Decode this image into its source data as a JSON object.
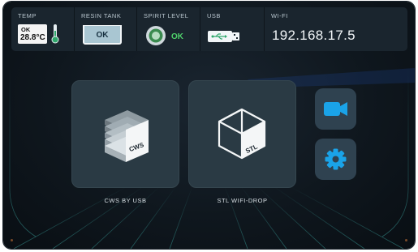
{
  "status_bar": {
    "temp": {
      "title": "TEMP",
      "status": "OK",
      "value": "28.8°C"
    },
    "resin_tank": {
      "title": "RESIN TANK",
      "status": "OK"
    },
    "spirit_level": {
      "title": "SPIRIT LEVEL",
      "status": "OK"
    },
    "usb": {
      "title": "USB"
    },
    "wifi": {
      "title": "WI-FI",
      "ip": "192.168.17.5"
    }
  },
  "main": {
    "cws_tile": {
      "label": "CWS BY USB",
      "icon_text": "CWS"
    },
    "stl_tile": {
      "label": "STL WIFI-DROP",
      "icon_text": "STL"
    }
  },
  "side_buttons": {
    "video": {
      "icon": "video-camera-icon"
    },
    "settings": {
      "icon": "gear-icon"
    }
  },
  "colors": {
    "background": "#0f171e",
    "panel": "#1a252e",
    "tile": "#2a3a44",
    "accent_blue": "#1aa3e8",
    "ok_green": "#4fd16b"
  }
}
